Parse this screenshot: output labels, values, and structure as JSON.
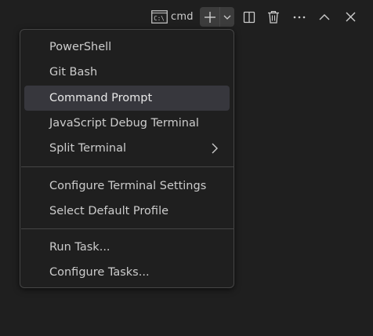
{
  "toolbar": {
    "terminal_tab": {
      "icon": "command-prompt-icon",
      "label": "cmd"
    },
    "new_terminal_icon": "plus-icon",
    "launch_profile_icon": "chevron-down-icon",
    "split_icon": "split-editor-icon",
    "kill_icon": "trash-icon",
    "more_icon": "ellipsis-icon",
    "maximize_icon": "chevron-up-icon",
    "close_icon": "close-icon"
  },
  "menu": {
    "items": [
      {
        "label": "PowerShell"
      },
      {
        "label": "Git Bash"
      },
      {
        "label": "Command Prompt"
      },
      {
        "label": "JavaScript Debug Terminal"
      },
      {
        "label": "Split Terminal",
        "submenu_icon": "chevron-right-icon"
      },
      {
        "label": "Configure Terminal Settings"
      },
      {
        "label": "Select Default Profile"
      },
      {
        "label": "Run Task..."
      },
      {
        "label": "Configure Tasks..."
      }
    ]
  },
  "colors": {
    "background": "#1f1f1f",
    "menu_border": "#454545",
    "highlight": "#37373d",
    "text": "#cccccc"
  }
}
